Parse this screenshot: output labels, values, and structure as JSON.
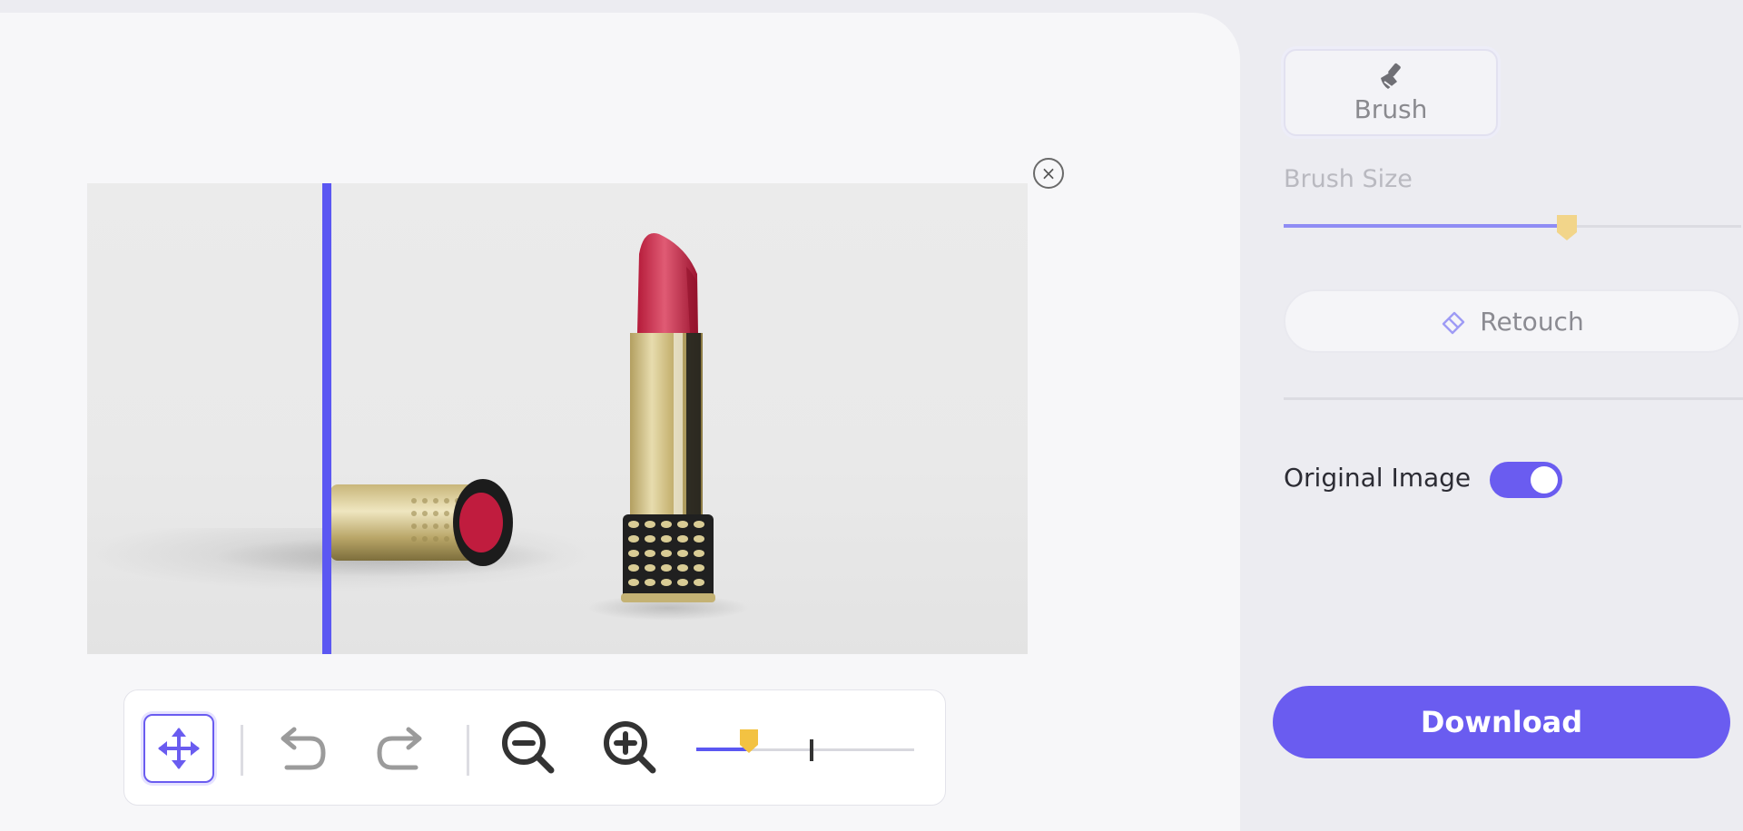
{
  "canvas": {
    "close_label": "×",
    "image_description": "lipstick-product-photo"
  },
  "toolbar": {
    "move_icon": "move-arrows-icon",
    "undo_icon": "undo-icon",
    "redo_icon": "redo-icon",
    "zoom_out_icon": "zoom-out-icon",
    "zoom_in_icon": "zoom-in-icon",
    "zoom_level_fraction": 0.24
  },
  "sidebar": {
    "brush_tab_label": "Brush",
    "brush_icon": "brush-icon",
    "brush_size_label": "Brush Size",
    "brush_size_fraction": 0.62,
    "retouch_label": "Retouch",
    "retouch_icon": "eraser-icon",
    "original_image_label": "Original Image",
    "original_image_on": true,
    "download_label": "Download"
  },
  "colors": {
    "accent": "#6a5cf0",
    "slider_thumb": "#f3c242",
    "brush_thumb": "#f2d58a",
    "lipstick": "#c3223f",
    "gold": "#c8b77a"
  }
}
